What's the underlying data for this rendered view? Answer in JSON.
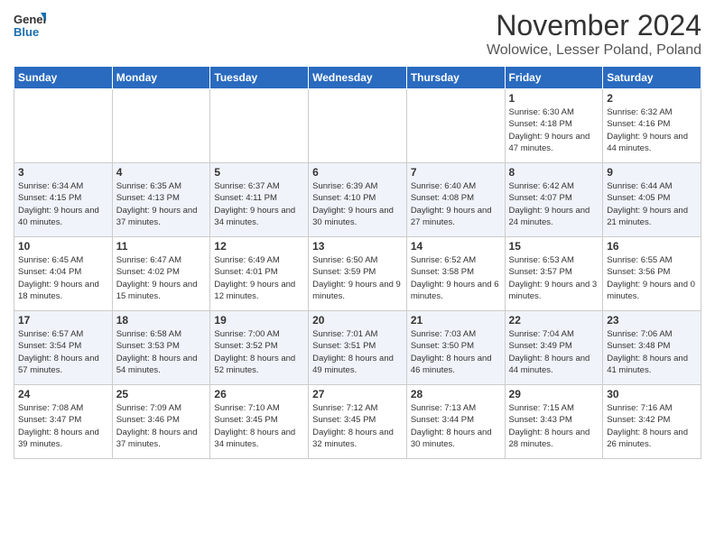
{
  "header": {
    "logo_general": "General",
    "logo_blue": "Blue",
    "title": "November 2024",
    "subtitle": "Wolowice, Lesser Poland, Poland"
  },
  "days_of_week": [
    "Sunday",
    "Monday",
    "Tuesday",
    "Wednesday",
    "Thursday",
    "Friday",
    "Saturday"
  ],
  "weeks": [
    [
      {
        "day": "",
        "info": ""
      },
      {
        "day": "",
        "info": ""
      },
      {
        "day": "",
        "info": ""
      },
      {
        "day": "",
        "info": ""
      },
      {
        "day": "",
        "info": ""
      },
      {
        "day": "1",
        "info": "Sunrise: 6:30 AM\nSunset: 4:18 PM\nDaylight: 9 hours and 47 minutes."
      },
      {
        "day": "2",
        "info": "Sunrise: 6:32 AM\nSunset: 4:16 PM\nDaylight: 9 hours and 44 minutes."
      }
    ],
    [
      {
        "day": "3",
        "info": "Sunrise: 6:34 AM\nSunset: 4:15 PM\nDaylight: 9 hours and 40 minutes."
      },
      {
        "day": "4",
        "info": "Sunrise: 6:35 AM\nSunset: 4:13 PM\nDaylight: 9 hours and 37 minutes."
      },
      {
        "day": "5",
        "info": "Sunrise: 6:37 AM\nSunset: 4:11 PM\nDaylight: 9 hours and 34 minutes."
      },
      {
        "day": "6",
        "info": "Sunrise: 6:39 AM\nSunset: 4:10 PM\nDaylight: 9 hours and 30 minutes."
      },
      {
        "day": "7",
        "info": "Sunrise: 6:40 AM\nSunset: 4:08 PM\nDaylight: 9 hours and 27 minutes."
      },
      {
        "day": "8",
        "info": "Sunrise: 6:42 AM\nSunset: 4:07 PM\nDaylight: 9 hours and 24 minutes."
      },
      {
        "day": "9",
        "info": "Sunrise: 6:44 AM\nSunset: 4:05 PM\nDaylight: 9 hours and 21 minutes."
      }
    ],
    [
      {
        "day": "10",
        "info": "Sunrise: 6:45 AM\nSunset: 4:04 PM\nDaylight: 9 hours and 18 minutes."
      },
      {
        "day": "11",
        "info": "Sunrise: 6:47 AM\nSunset: 4:02 PM\nDaylight: 9 hours and 15 minutes."
      },
      {
        "day": "12",
        "info": "Sunrise: 6:49 AM\nSunset: 4:01 PM\nDaylight: 9 hours and 12 minutes."
      },
      {
        "day": "13",
        "info": "Sunrise: 6:50 AM\nSunset: 3:59 PM\nDaylight: 9 hours and 9 minutes."
      },
      {
        "day": "14",
        "info": "Sunrise: 6:52 AM\nSunset: 3:58 PM\nDaylight: 9 hours and 6 minutes."
      },
      {
        "day": "15",
        "info": "Sunrise: 6:53 AM\nSunset: 3:57 PM\nDaylight: 9 hours and 3 minutes."
      },
      {
        "day": "16",
        "info": "Sunrise: 6:55 AM\nSunset: 3:56 PM\nDaylight: 9 hours and 0 minutes."
      }
    ],
    [
      {
        "day": "17",
        "info": "Sunrise: 6:57 AM\nSunset: 3:54 PM\nDaylight: 8 hours and 57 minutes."
      },
      {
        "day": "18",
        "info": "Sunrise: 6:58 AM\nSunset: 3:53 PM\nDaylight: 8 hours and 54 minutes."
      },
      {
        "day": "19",
        "info": "Sunrise: 7:00 AM\nSunset: 3:52 PM\nDaylight: 8 hours and 52 minutes."
      },
      {
        "day": "20",
        "info": "Sunrise: 7:01 AM\nSunset: 3:51 PM\nDaylight: 8 hours and 49 minutes."
      },
      {
        "day": "21",
        "info": "Sunrise: 7:03 AM\nSunset: 3:50 PM\nDaylight: 8 hours and 46 minutes."
      },
      {
        "day": "22",
        "info": "Sunrise: 7:04 AM\nSunset: 3:49 PM\nDaylight: 8 hours and 44 minutes."
      },
      {
        "day": "23",
        "info": "Sunrise: 7:06 AM\nSunset: 3:48 PM\nDaylight: 8 hours and 41 minutes."
      }
    ],
    [
      {
        "day": "24",
        "info": "Sunrise: 7:08 AM\nSunset: 3:47 PM\nDaylight: 8 hours and 39 minutes."
      },
      {
        "day": "25",
        "info": "Sunrise: 7:09 AM\nSunset: 3:46 PM\nDaylight: 8 hours and 37 minutes."
      },
      {
        "day": "26",
        "info": "Sunrise: 7:10 AM\nSunset: 3:45 PM\nDaylight: 8 hours and 34 minutes."
      },
      {
        "day": "27",
        "info": "Sunrise: 7:12 AM\nSunset: 3:45 PM\nDaylight: 8 hours and 32 minutes."
      },
      {
        "day": "28",
        "info": "Sunrise: 7:13 AM\nSunset: 3:44 PM\nDaylight: 8 hours and 30 minutes."
      },
      {
        "day": "29",
        "info": "Sunrise: 7:15 AM\nSunset: 3:43 PM\nDaylight: 8 hours and 28 minutes."
      },
      {
        "day": "30",
        "info": "Sunrise: 7:16 AM\nSunset: 3:42 PM\nDaylight: 8 hours and 26 minutes."
      }
    ]
  ]
}
